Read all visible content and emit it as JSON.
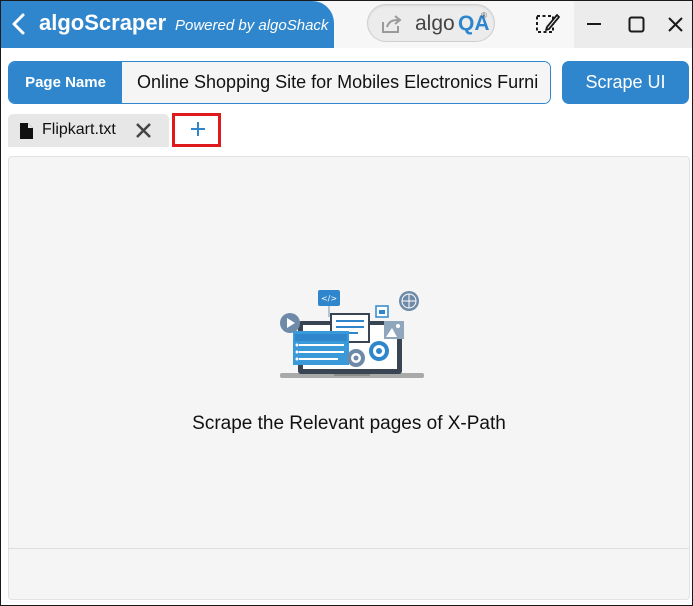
{
  "header": {
    "app_title": "algoScraper",
    "powered_by": "Powered by algoShack",
    "algoqa": {
      "part1": "algo",
      "part2": "QA",
      "registered": "®"
    }
  },
  "page_name": {
    "label": "Page Name",
    "value": "Online Shopping Site for Mobiles Electronics Furni"
  },
  "scrape_button": {
    "label": "Scrape UI"
  },
  "tabs": [
    {
      "label": "Flipkart.txt",
      "icon": "file-icon"
    }
  ],
  "add_tab": {
    "label": "+"
  },
  "content": {
    "message": "Scrape the Relevant pages of X-Path"
  },
  "colors": {
    "accent": "#2f86cc",
    "highlight": "#e0191c",
    "panel": "#f5f5f5"
  }
}
